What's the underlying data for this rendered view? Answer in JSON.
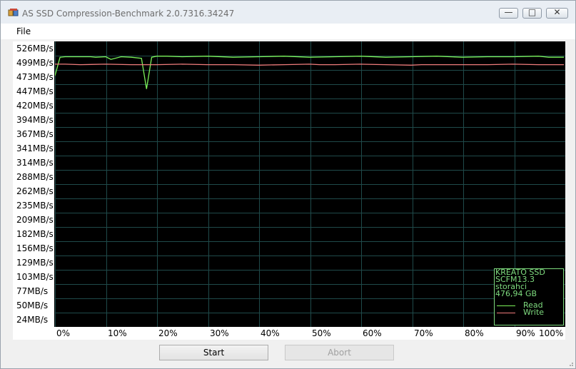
{
  "window": {
    "title": "AS SSD Compression-Benchmark 2.0.7316.34247",
    "controls": {
      "minimize": "—",
      "maximize": "□",
      "close": "✕"
    }
  },
  "menu": {
    "file": "File"
  },
  "buttons": {
    "start": "Start",
    "abort": "Abort"
  },
  "legend": {
    "line1": "KREATO SSD",
    "line2": "SCFM13.3",
    "line3": "storahci",
    "line4": "476,94 GB",
    "read": "Read",
    "write": "Write"
  },
  "colors": {
    "read": "#7cf35a",
    "write": "#f07c7c",
    "grid": "#1f4a4a",
    "plot_bg": "#000000"
  },
  "chart_data": {
    "type": "line",
    "y_tick_labels": [
      "526MB/s",
      "499MB/s",
      "473MB/s",
      "447MB/s",
      "420MB/s",
      "394MB/s",
      "367MB/s",
      "341MB/s",
      "314MB/s",
      "288MB/s",
      "262MB/s",
      "235MB/s",
      "209MB/s",
      "182MB/s",
      "156MB/s",
      "129MB/s",
      "103MB/s",
      "77MB/s",
      "50MB/s",
      "24MB/s"
    ],
    "x_tick_labels": [
      "0%",
      "10%",
      "20%",
      "30%",
      "40%",
      "50%",
      "60%",
      "70%",
      "80%",
      "90%",
      "100%"
    ],
    "xlim": [
      0,
      100
    ],
    "ylim": [
      0,
      540
    ],
    "grid": true,
    "legend_position": "bottom-right",
    "series": [
      {
        "name": "Read",
        "x": [
          0,
          1,
          2,
          5,
          7,
          8,
          10,
          11,
          13,
          15,
          17,
          18,
          19,
          20,
          22,
          25,
          30,
          35,
          40,
          45,
          50,
          55,
          60,
          65,
          70,
          75,
          80,
          85,
          90,
          95,
          97,
          100
        ],
        "y": [
          475,
          510,
          511,
          511,
          511,
          510,
          511,
          506,
          511,
          510,
          508,
          450,
          510,
          512,
          512,
          511,
          512,
          510,
          511,
          512,
          510,
          511,
          512,
          510,
          511,
          512,
          510,
          511,
          511,
          512,
          510,
          510
        ]
      },
      {
        "name": "Write",
        "x": [
          0,
          2,
          5,
          10,
          15,
          20,
          25,
          30,
          35,
          40,
          45,
          50,
          52,
          55,
          60,
          65,
          70,
          72,
          75,
          80,
          85,
          90,
          95,
          100
        ],
        "y": [
          497,
          497,
          496,
          497,
          496,
          496,
          497,
          496,
          496,
          495,
          496,
          497,
          496,
          496,
          497,
          496,
          495,
          496,
          496,
          496,
          496,
          497,
          496,
          496
        ]
      }
    ]
  }
}
